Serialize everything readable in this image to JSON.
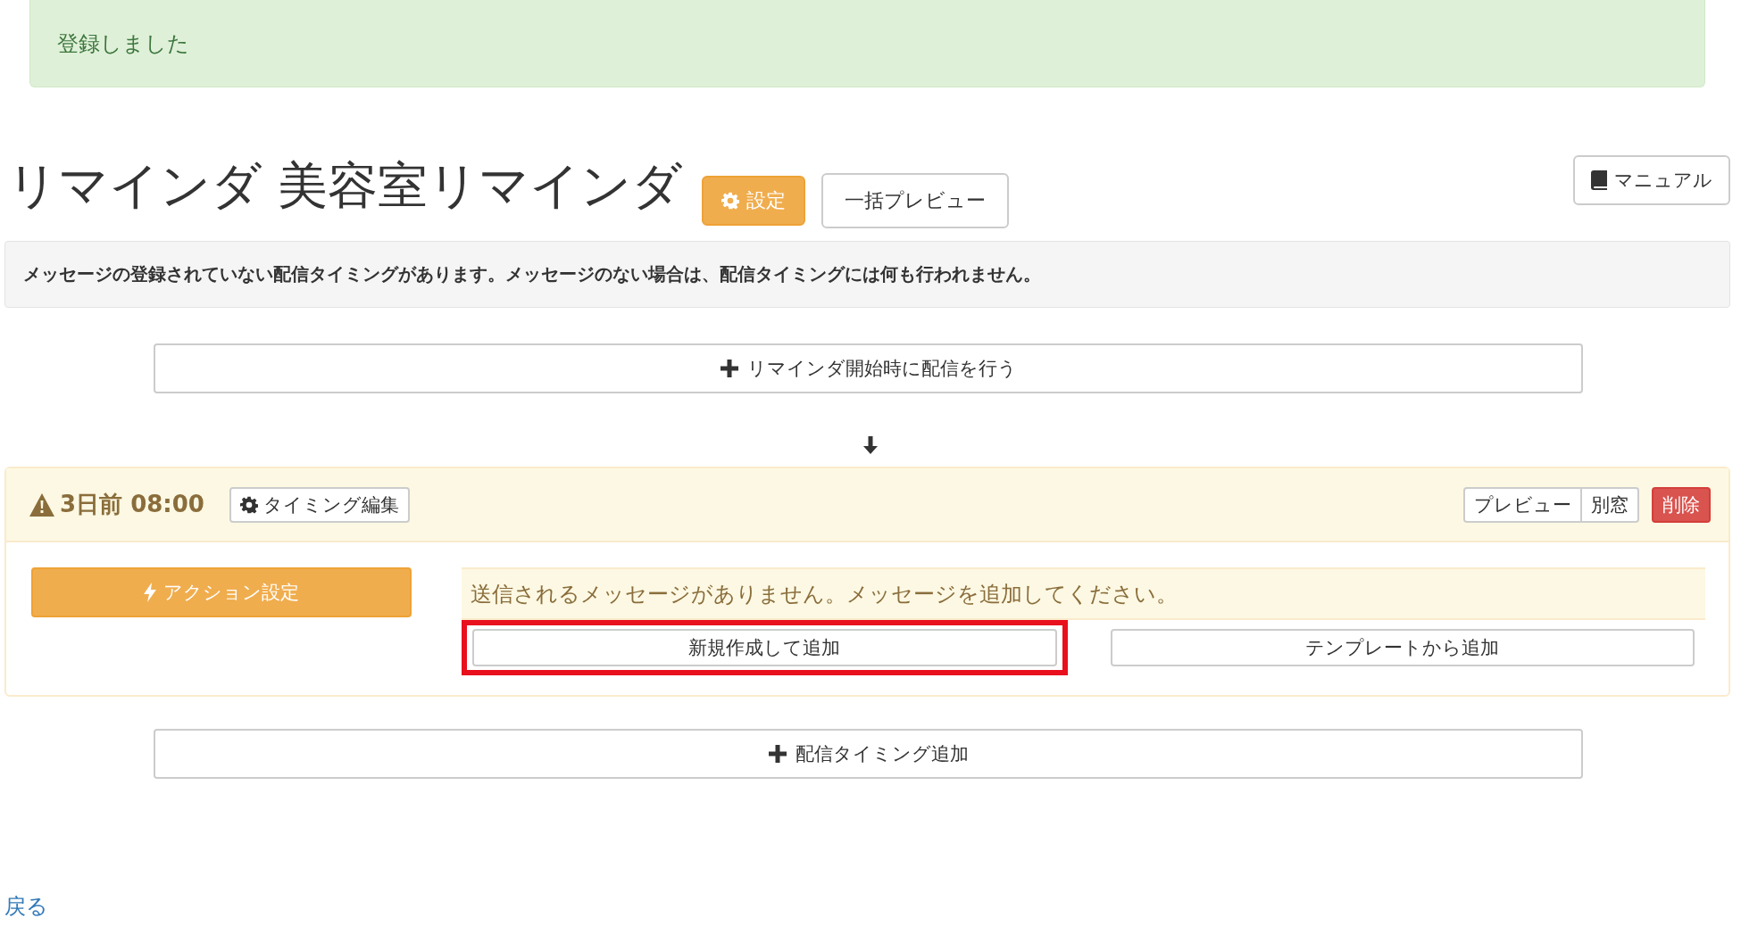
{
  "alert": {
    "text": "登録しました"
  },
  "header": {
    "title": "リマインダ 美容室リマインダ",
    "buttons": [
      {
        "label": "設定",
        "kind": "settings"
      },
      {
        "label": "一括プレビュー",
        "kind": "default"
      }
    ],
    "manual_button": {
      "label": "マニュアル"
    }
  },
  "notice": "メッセージの登録されていない配信タイミングがあります。メッセージのない場合は、配信タイミングには何も行われません。",
  "add_start_button": {
    "label": "リマインダ開始時に配信を行う"
  },
  "timings": [
    {
      "title": "3日前 08:00",
      "edit_button": "タイミング編集",
      "preview_button": "プレビュー",
      "window_button": "別窓",
      "delete_button": "削除",
      "action_button": "アクション設定",
      "empty_message": "送信されるメッセージがありません。メッセージを追加してください。",
      "add_buttons": [
        {
          "label": "新規作成して追加",
          "highlighted": true
        },
        {
          "label": "テンプレートから追加",
          "highlighted": false
        }
      ]
    }
  ],
  "add_timing_button": {
    "label": "配信タイミング追加"
  },
  "back_link": "戻る"
}
